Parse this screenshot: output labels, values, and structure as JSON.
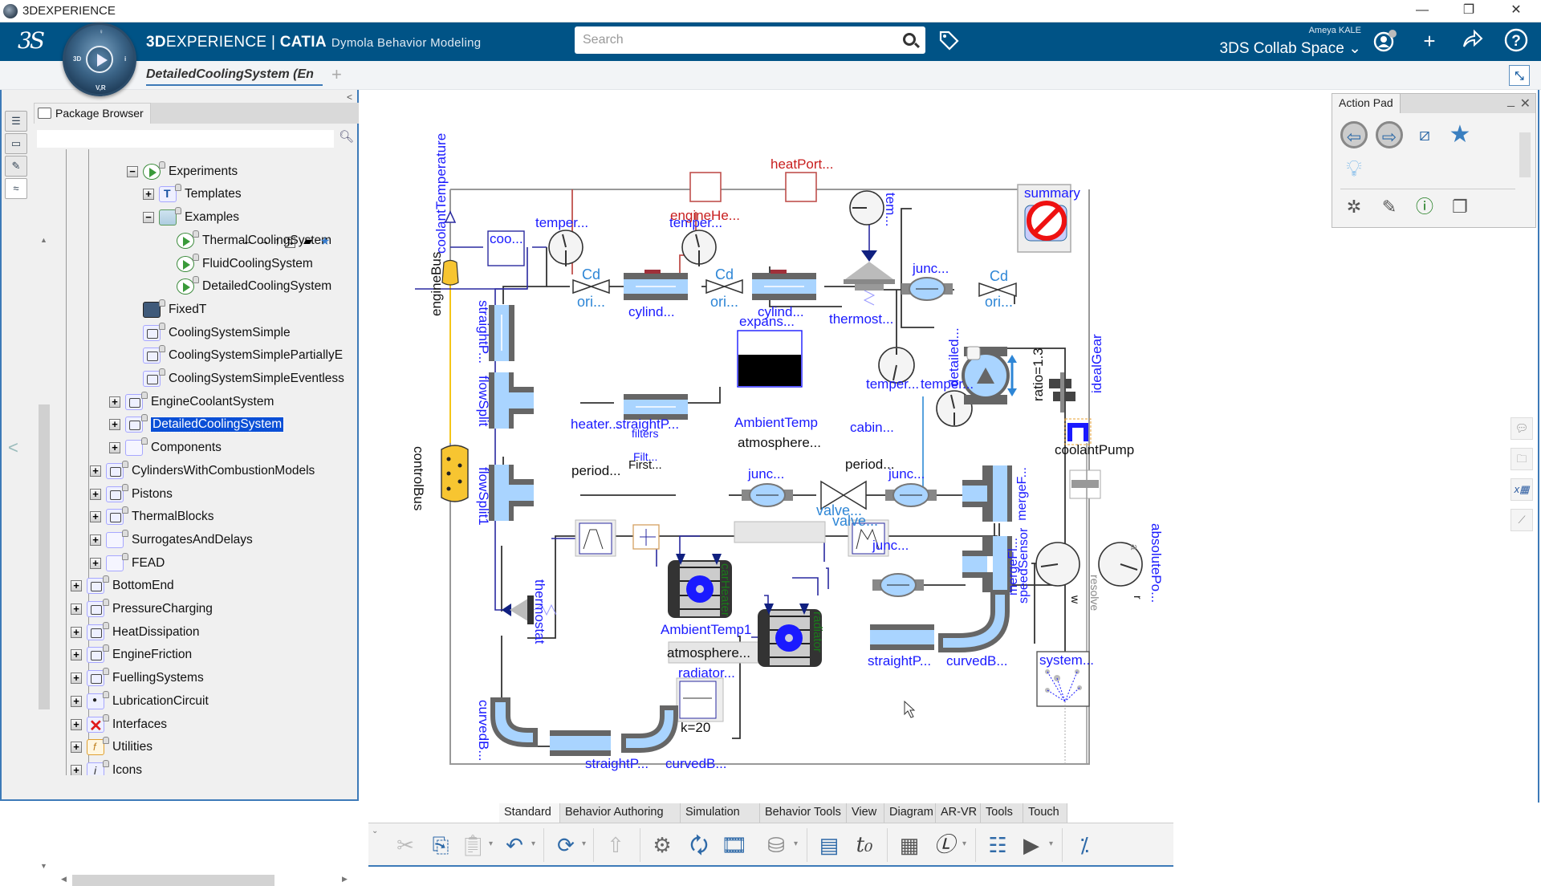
{
  "window": {
    "title": "3DEXPERIENCE",
    "controls": {
      "minimize": "—",
      "maximize": "❐",
      "close": "✕"
    }
  },
  "header": {
    "brand_bold": "3D",
    "brand_rest": "EXPERIENCE | ",
    "brand_catia": "CATIA",
    "brand_app": "Dymola Behavior Modeling",
    "compass_labels": {
      "left": "3D",
      "right": "i",
      "bottom": "V,R"
    },
    "search_placeholder": "Search",
    "user_name": "Ameya KALE",
    "collab_space": "3DS Collab Space ⌄",
    "icons": [
      "tag-icon",
      "user-profile-icon",
      "add-icon",
      "share-icon",
      "help-icon"
    ]
  },
  "editor_tabs": {
    "active": "DetailedCoolingSystem (En",
    "add": "+",
    "restore": "⤡"
  },
  "package_browser": {
    "title": "Package Browser",
    "filter_value": "",
    "nav_icons": [
      "back-arrow-icon",
      "forward-arrow-icon",
      "up-arrow-icon",
      "sort-icon",
      "library-icon",
      "favorite-star-icon"
    ],
    "tree": [
      {
        "label": "Examples",
        "level": 3,
        "expander": "-",
        "icon": "pkg",
        "partial": true
      },
      {
        "label": "Experiments",
        "level": 3,
        "expander": "-",
        "icon": "play"
      },
      {
        "label": "Templates",
        "level": 4,
        "expander": "+",
        "icon": "Tbox"
      },
      {
        "label": "Examples",
        "level": 4,
        "expander": "-",
        "icon": "pkg"
      },
      {
        "label": "ThermalCoolingSystem",
        "level": 5,
        "expander": "",
        "icon": "play"
      },
      {
        "label": "FluidCoolingSystem",
        "level": 5,
        "expander": "",
        "icon": "play"
      },
      {
        "label": "DetailedCoolingSystem",
        "level": 5,
        "expander": "",
        "icon": "play"
      },
      {
        "label": "FixedT",
        "level": 3,
        "expander": "",
        "icon": "dark"
      },
      {
        "label": "CoolingSystemSimple",
        "level": 3,
        "expander": "",
        "icon": "gen"
      },
      {
        "label": "CoolingSystemSimplePartiallyE",
        "level": 3,
        "expander": "",
        "icon": "gen"
      },
      {
        "label": "CoolingSystemSimpleEventless",
        "level": 3,
        "expander": "",
        "icon": "gen"
      },
      {
        "label": "EngineCoolantSystem",
        "level": 2,
        "expander": "+",
        "icon": "gen"
      },
      {
        "label": "DetailedCoolingSystem",
        "level": 2,
        "expander": "+",
        "icon": "gen",
        "selected": true
      },
      {
        "label": "Components",
        "level": 2,
        "expander": "+",
        "icon": "plain"
      },
      {
        "label": "CylindersWithCombustionModels",
        "level": 1,
        "expander": "+",
        "icon": "gen"
      },
      {
        "label": "Pistons",
        "level": 1,
        "expander": "+",
        "icon": "gen"
      },
      {
        "label": "ThermalBlocks",
        "level": 1,
        "expander": "+",
        "icon": "gen"
      },
      {
        "label": "SurrogatesAndDelays",
        "level": 1,
        "expander": "+",
        "icon": "plain"
      },
      {
        "label": "FEAD",
        "level": 1,
        "expander": "+",
        "icon": "plain"
      },
      {
        "label": "BottomEnd",
        "level": 0,
        "expander": "+",
        "icon": "gen"
      },
      {
        "label": "PressureCharging",
        "level": 0,
        "expander": "+",
        "icon": "gen"
      },
      {
        "label": "HeatDissipation",
        "level": 0,
        "expander": "+",
        "icon": "gen"
      },
      {
        "label": "EngineFriction",
        "level": 0,
        "expander": "+",
        "icon": "gen"
      },
      {
        "label": "FuellingSystems",
        "level": 0,
        "expander": "+",
        "icon": "gen"
      },
      {
        "label": "LubricationCircuit",
        "level": 0,
        "expander": "+",
        "icon": "drop"
      },
      {
        "label": "Interfaces",
        "level": 0,
        "expander": "+",
        "icon": "redx"
      },
      {
        "label": "Utilities",
        "level": 0,
        "expander": "+",
        "icon": "util"
      },
      {
        "label": "Icons",
        "level": 0,
        "expander": "+",
        "icon": "info"
      }
    ]
  },
  "diagram": {
    "labels": {
      "coolantTemperature": "coolantTemperature",
      "engineBus": "engineBus",
      "controlBus": "controlBus",
      "coo": "coo...",
      "temper1": "temper...",
      "temper2": "temper...",
      "cd1": "Cd",
      "ori1": "ori...",
      "cd2": "Cd",
      "ori2": "ori...",
      "cd3": "Cd",
      "ori3": "ori...",
      "cylind1": "cylind...",
      "cylind2": "cylind...",
      "engineHe": "engineHe...",
      "heatPort": "heatPort...",
      "tem": "tem...",
      "thermost": "thermost...",
      "junc1": "junc...",
      "junc2": "junc...",
      "junc3": "junc...",
      "junc4": "junc...",
      "expans": "expans...",
      "straightP_v": "straightP...",
      "flowSplit": "flowSplit",
      "flowSplit1": "flowSplit1",
      "straightP_h": "straightP...",
      "heater": "heater...",
      "filters": "filters",
      "filt": "Filt...",
      "first": "First...",
      "period1": "period...",
      "period2": "period...",
      "ambientTemp": "AmbientTemp",
      "atmosphere1": "atmosphere...",
      "carHeater": "carHeater",
      "valve1": "valve...",
      "valve2": "valve...",
      "cabin": "cabin...",
      "temperA": "temper...",
      "temperB": "temper...",
      "detailed": "detailed...",
      "ratio": "ratio=1.3",
      "idealGear": "idealGear",
      "coolantPump": "coolantPump",
      "mergeF": "mergeF...",
      "mergeFl": "mergeFl...",
      "speedSensor": "speedSensor",
      "w": "w",
      "r": "r",
      "a": "a",
      "resolve": "resolve",
      "absolutePo": "absolutePo...",
      "summary": "summary",
      "ambientTemp1": "AmbientTemp1",
      "atmosphere2": "atmosphere...",
      "radiatorSrc": "radiator...",
      "k": "k=20",
      "radiator": "radiator",
      "thermostat": "thermostat",
      "straightP_b1": "straightP...",
      "curvedB1": "curvedB...",
      "straightP_b2": "straightP...",
      "curvedB2": "curvedB...",
      "curvedB_v": "curvedB...",
      "system": "system..."
    }
  },
  "action_pad": {
    "title": "Action Pad",
    "minimize": "_",
    "close": "✕",
    "icons": [
      "back-icon",
      "forward-icon",
      "connect-mode-icon",
      "favorite-icon",
      "hint-icon",
      "new-model-icon",
      "edit-icon",
      "info-document-icon",
      "duplicate-icon"
    ]
  },
  "right_strip": {
    "icons": [
      "comment-icon",
      "folder-icon",
      "variables-table-icon",
      "plot-icon"
    ]
  },
  "bottom_tabs": [
    {
      "label": "Standard",
      "active": true
    },
    {
      "label": "Behavior Authoring",
      "active": false
    },
    {
      "label": "Simulation",
      "active": false
    },
    {
      "label": "Behavior Tools",
      "active": false
    },
    {
      "label": "View",
      "active": false
    },
    {
      "label": "Diagram",
      "active": false
    },
    {
      "label": "AR-VR",
      "active": false
    },
    {
      "label": "Tools",
      "active": false
    },
    {
      "label": "Touch",
      "active": false
    }
  ],
  "toolbar": {
    "icons": [
      "cut-icon",
      "copy-icon",
      "paste-icon",
      "undo-icon",
      "refresh-cycle-icon",
      "export-icon",
      "translate-icon",
      "simulate-refresh-icon",
      "animation-icon",
      "database-run-icon",
      "results-list-icon",
      "initial-time-icon",
      "parameter-sweep-icon",
      "linearize-icon",
      "script-list-icon",
      "run-script-icon",
      "fraction-icon"
    ]
  }
}
